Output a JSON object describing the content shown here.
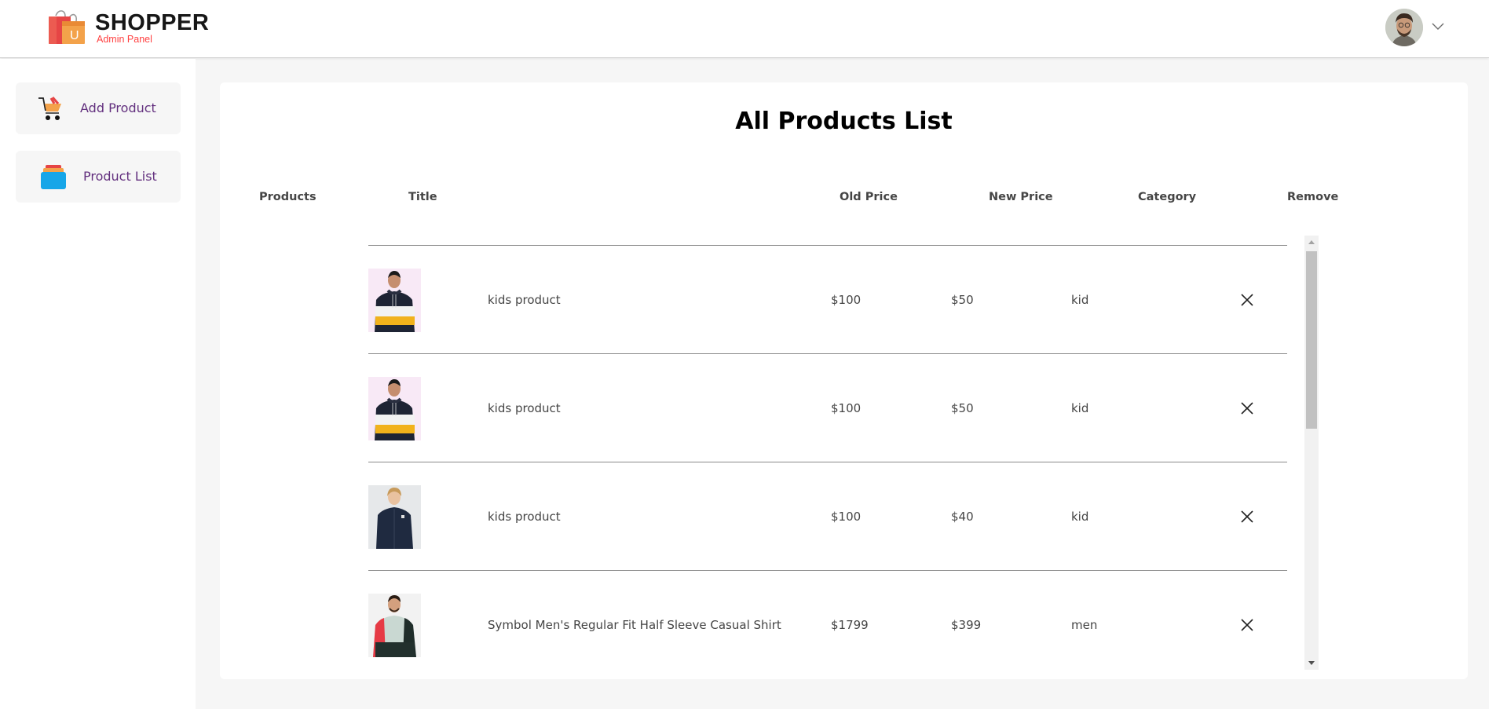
{
  "navbar": {
    "brand": "SHOPPER",
    "subtitle": "Admin Panel",
    "logo_icon": "shopping-bag-icon",
    "avatar_icon": "user-avatar",
    "dropdown_icon": "chevron-down-icon"
  },
  "sidebar": {
    "items": [
      {
        "label": "Add Product",
        "icon": "cart-icon"
      },
      {
        "label": "Product List",
        "icon": "stacked-list-icon"
      }
    ]
  },
  "main": {
    "title": "All Products List",
    "columns": [
      "Products",
      "Title",
      "Old Price",
      "New Price",
      "Category",
      "Remove"
    ],
    "rows": [
      {
        "image": "kids-hoodie-image",
        "title": "kids product",
        "old_price": "$100",
        "new_price": "$50",
        "category": "kid"
      },
      {
        "image": "kids-hoodie-image",
        "title": "kids product",
        "old_price": "$100",
        "new_price": "$50",
        "category": "kid"
      },
      {
        "image": "kids-jacket-image",
        "title": "kids product",
        "old_price": "$100",
        "new_price": "$40",
        "category": "kid"
      },
      {
        "image": "mens-jacket-image",
        "title": "Symbol Men's Regular Fit Half Sleeve Casual Shirt",
        "old_price": "$1799",
        "new_price": "$399",
        "category": "men"
      }
    ]
  },
  "colors": {
    "brand_red": "#ff4141",
    "sidebar_text": "#622f7e",
    "background": "#f6f6f6"
  }
}
